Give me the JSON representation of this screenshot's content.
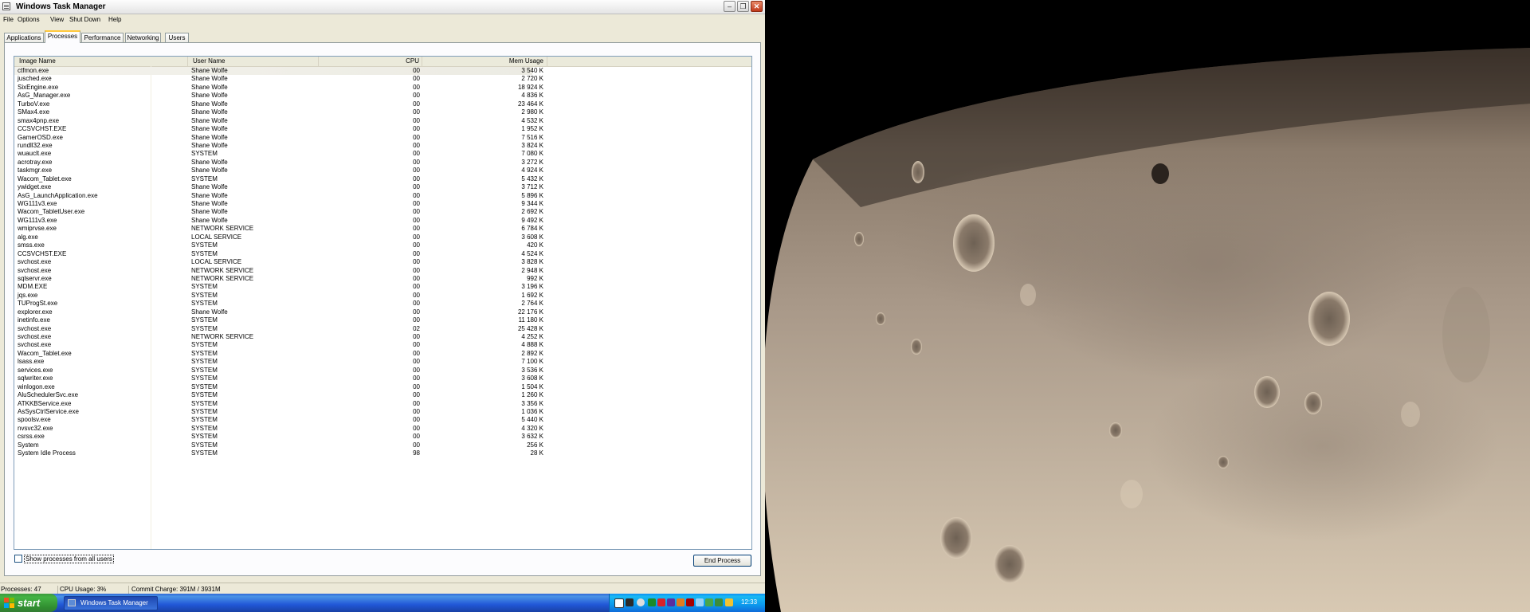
{
  "window": {
    "title": "Windows Task Manager",
    "min_glyph": "–",
    "max_glyph": "❐",
    "close_glyph": "✕"
  },
  "menu": [
    "File",
    "Options",
    "View",
    "Shut Down",
    "Help"
  ],
  "tabs": [
    "Applications",
    "Processes",
    "Performance",
    "Networking",
    "Users"
  ],
  "active_tab": "Processes",
  "columns": {
    "image_name": "Image Name",
    "user_name": "User Name",
    "cpu": "CPU",
    "mem_usage": "Mem Usage"
  },
  "processes": [
    {
      "name": "ctfmon.exe",
      "user": "Shane Wolfe",
      "cpu": "00",
      "mem": "3 540 K"
    },
    {
      "name": "jusched.exe",
      "user": "Shane Wolfe",
      "cpu": "00",
      "mem": "2 720 K"
    },
    {
      "name": "SixEngine.exe",
      "user": "Shane Wolfe",
      "cpu": "00",
      "mem": "18 924 K"
    },
    {
      "name": "AsG_Manager.exe",
      "user": "Shane Wolfe",
      "cpu": "00",
      "mem": "4 836 K"
    },
    {
      "name": "TurboV.exe",
      "user": "Shane Wolfe",
      "cpu": "00",
      "mem": "23 464 K"
    },
    {
      "name": "SMax4.exe",
      "user": "Shane Wolfe",
      "cpu": "00",
      "mem": "2 980 K"
    },
    {
      "name": "smax4pnp.exe",
      "user": "Shane Wolfe",
      "cpu": "00",
      "mem": "4 532 K"
    },
    {
      "name": "CCSVCHST.EXE",
      "user": "Shane Wolfe",
      "cpu": "00",
      "mem": "1 952 K"
    },
    {
      "name": "GamerOSD.exe",
      "user": "Shane Wolfe",
      "cpu": "00",
      "mem": "7 516 K"
    },
    {
      "name": "rundll32.exe",
      "user": "Shane Wolfe",
      "cpu": "00",
      "mem": "3 824 K"
    },
    {
      "name": "wuauclt.exe",
      "user": "SYSTEM",
      "cpu": "00",
      "mem": "7 080 K"
    },
    {
      "name": "acrotray.exe",
      "user": "Shane Wolfe",
      "cpu": "00",
      "mem": "3 272 K"
    },
    {
      "name": "taskmgr.exe",
      "user": "Shane Wolfe",
      "cpu": "00",
      "mem": "4 924 K"
    },
    {
      "name": "Wacom_Tablet.exe",
      "user": "SYSTEM",
      "cpu": "00",
      "mem": "5 432 K"
    },
    {
      "name": "ywidget.exe",
      "user": "Shane Wolfe",
      "cpu": "00",
      "mem": "3 712 K"
    },
    {
      "name": "AsG_LaunchApplication.exe",
      "user": "Shane Wolfe",
      "cpu": "00",
      "mem": "5 896 K"
    },
    {
      "name": "WG111v3.exe",
      "user": "Shane Wolfe",
      "cpu": "00",
      "mem": "9 344 K"
    },
    {
      "name": "Wacom_TabletUser.exe",
      "user": "Shane Wolfe",
      "cpu": "00",
      "mem": "2 692 K"
    },
    {
      "name": "WG111v3.exe",
      "user": "Shane Wolfe",
      "cpu": "00",
      "mem": "9 492 K"
    },
    {
      "name": "wmiprvse.exe",
      "user": "NETWORK SERVICE",
      "cpu": "00",
      "mem": "6 784 K"
    },
    {
      "name": "alg.exe",
      "user": "LOCAL SERVICE",
      "cpu": "00",
      "mem": "3 608 K"
    },
    {
      "name": "smss.exe",
      "user": "SYSTEM",
      "cpu": "00",
      "mem": "420 K"
    },
    {
      "name": "CCSVCHST.EXE",
      "user": "SYSTEM",
      "cpu": "00",
      "mem": "4 524 K"
    },
    {
      "name": "svchost.exe",
      "user": "LOCAL SERVICE",
      "cpu": "00",
      "mem": "3 828 K"
    },
    {
      "name": "svchost.exe",
      "user": "NETWORK SERVICE",
      "cpu": "00",
      "mem": "2 948 K"
    },
    {
      "name": "sqlservr.exe",
      "user": "NETWORK SERVICE",
      "cpu": "00",
      "mem": "992 K"
    },
    {
      "name": "MDM.EXE",
      "user": "SYSTEM",
      "cpu": "00",
      "mem": "3 196 K"
    },
    {
      "name": "jqs.exe",
      "user": "SYSTEM",
      "cpu": "00",
      "mem": "1 692 K"
    },
    {
      "name": "TUProgSt.exe",
      "user": "SYSTEM",
      "cpu": "00",
      "mem": "2 764 K"
    },
    {
      "name": "explorer.exe",
      "user": "Shane Wolfe",
      "cpu": "00",
      "mem": "22 176 K"
    },
    {
      "name": "inetinfo.exe",
      "user": "SYSTEM",
      "cpu": "00",
      "mem": "11 180 K"
    },
    {
      "name": "svchost.exe",
      "user": "SYSTEM",
      "cpu": "02",
      "mem": "25 428 K"
    },
    {
      "name": "svchost.exe",
      "user": "NETWORK SERVICE",
      "cpu": "00",
      "mem": "4 252 K"
    },
    {
      "name": "svchost.exe",
      "user": "SYSTEM",
      "cpu": "00",
      "mem": "4 888 K"
    },
    {
      "name": "Wacom_Tablet.exe",
      "user": "SYSTEM",
      "cpu": "00",
      "mem": "2 892 K"
    },
    {
      "name": "lsass.exe",
      "user": "SYSTEM",
      "cpu": "00",
      "mem": "7 100 K"
    },
    {
      "name": "services.exe",
      "user": "SYSTEM",
      "cpu": "00",
      "mem": "3 536 K"
    },
    {
      "name": "sqlwriter.exe",
      "user": "SYSTEM",
      "cpu": "00",
      "mem": "3 608 K"
    },
    {
      "name": "winlogon.exe",
      "user": "SYSTEM",
      "cpu": "00",
      "mem": "1 504 K"
    },
    {
      "name": "AluSchedulerSvc.exe",
      "user": "SYSTEM",
      "cpu": "00",
      "mem": "1 260 K"
    },
    {
      "name": "ATKKBService.exe",
      "user": "SYSTEM",
      "cpu": "00",
      "mem": "3 356 K"
    },
    {
      "name": "AsSysCtrlService.exe",
      "user": "SYSTEM",
      "cpu": "00",
      "mem": "1 036 K"
    },
    {
      "name": "spoolsv.exe",
      "user": "SYSTEM",
      "cpu": "00",
      "mem": "5 440 K"
    },
    {
      "name": "nvsvc32.exe",
      "user": "SYSTEM",
      "cpu": "00",
      "mem": "4 320 K"
    },
    {
      "name": "csrss.exe",
      "user": "SYSTEM",
      "cpu": "00",
      "mem": "3 632 K"
    },
    {
      "name": "System",
      "user": "SYSTEM",
      "cpu": "00",
      "mem": "256 K"
    },
    {
      "name": "System Idle Process",
      "user": "SYSTEM",
      "cpu": "98",
      "mem": "28 K"
    }
  ],
  "show_all_label": "Show processes from all users",
  "end_process_label": "End Process",
  "status": {
    "processes": "Processes: 47",
    "cpu_usage": "CPU Usage: 3%",
    "commit_charge": "Commit Charge: 391M / 3931M"
  },
  "taskbar": {
    "start_label": "start",
    "task_label": "Windows Task Manager",
    "clock": "12:33"
  },
  "colors": {
    "accent_tab": "#ffc83c",
    "taskbar_blue": "#245edb",
    "start_green": "#3c9a3c",
    "close_red": "#c0391b"
  }
}
